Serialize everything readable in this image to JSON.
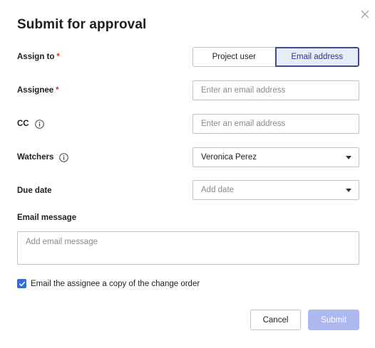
{
  "dialog": {
    "title": "Submit for approval",
    "close_icon": "close-icon"
  },
  "assign_to": {
    "label": "Assign to",
    "required_mark": "*",
    "options": [
      {
        "label": "Project user",
        "selected": false
      },
      {
        "label": "Email address",
        "selected": true
      }
    ]
  },
  "assignee": {
    "label": "Assignee",
    "required_mark": "*",
    "value": "",
    "placeholder": "Enter an email address"
  },
  "cc": {
    "label": "CC",
    "info_icon": "info-icon",
    "value": "",
    "placeholder": "Enter an email address"
  },
  "watchers": {
    "label": "Watchers",
    "info_icon": "info-icon",
    "selected_value": "Veronica Perez"
  },
  "due_date": {
    "label": "Due date",
    "placeholder": "Add date"
  },
  "email_message": {
    "label": "Email message",
    "placeholder": "Add email message"
  },
  "copy_checkbox": {
    "label": "Email the assignee a copy of the change order",
    "checked": true
  },
  "footer": {
    "cancel_label": "Cancel",
    "submit_label": "Submit"
  },
  "colors": {
    "accent": "#3a4a9c",
    "accent_bg": "#e8ecf8",
    "checkbox": "#3a6ad6",
    "submit_disabled": "#aeb8f0",
    "required": "#d0342c"
  }
}
